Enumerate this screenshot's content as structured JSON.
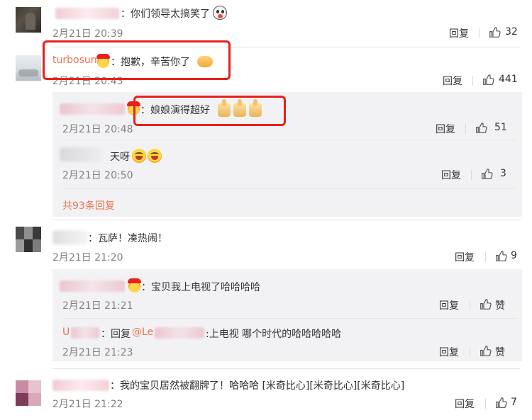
{
  "comments": [
    {
      "text": "：你们领导太搞笑了",
      "emoji": "shocked-face-icon",
      "time": "2月21日 20:39",
      "reply_label": "回复",
      "likes": "32"
    },
    {
      "username": "turbosun",
      "text": "：抱歉，辛苦你了",
      "emoji": "handshake-icon",
      "time": "2月21日 20:43",
      "reply_label": "回复",
      "likes": "441",
      "replies": [
        {
          "text": "：娘娘演得超好",
          "emoji": "thumbs-up-icon",
          "time": "2月21日 20:48",
          "reply_label": "回复",
          "likes": "51"
        },
        {
          "text": "天呀",
          "emoji": "laughing-face-icon",
          "time": "2月21日 20:50",
          "reply_label": "回复",
          "likes": "3"
        }
      ],
      "more_replies": "共93条回复"
    },
    {
      "text": "：瓦萨！凑热闹！",
      "time": "2月21日 21:20",
      "reply_label": "回复",
      "likes": "9",
      "replies": [
        {
          "text": "：宝贝我上电视了哈哈哈哈",
          "time": "2月21日 21:21",
          "reply_label": "回复",
          "likes": "赞"
        },
        {
          "name_prefix": "U",
          "reply_word": "：回复",
          "mention": "@Le",
          "text": ":上电视 哪个时代的哈哈哈哈哈",
          "time": "2月21日 21:23",
          "reply_label": "回复",
          "likes": "赞"
        }
      ]
    },
    {
      "text": "：我的宝贝居然被翻牌了！哈哈哈 [米奇比心][米奇比心][米奇比心]",
      "time": "2月21日 21:22",
      "reply_label": "回复",
      "likes": "7"
    }
  ],
  "colors": {
    "username": "#eb7350",
    "highlight_box": "#e8201c",
    "reply_bg": "#f2f2f5"
  }
}
